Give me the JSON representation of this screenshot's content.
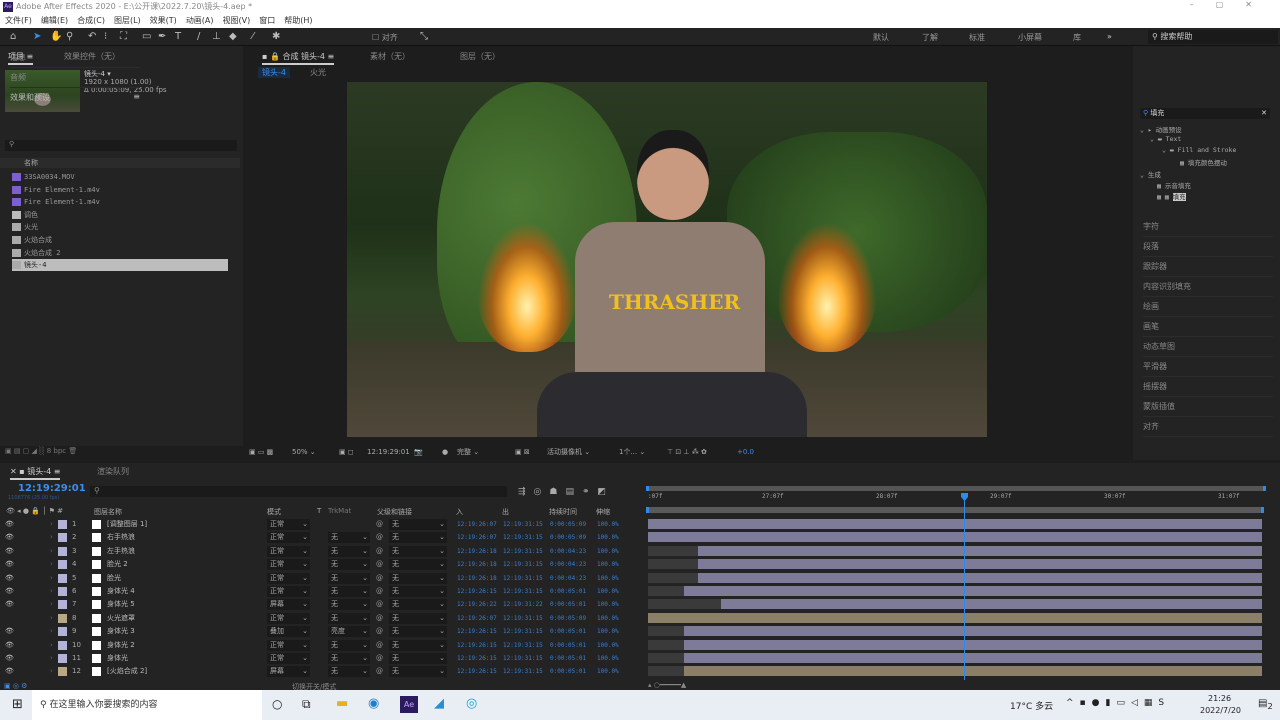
{
  "app": {
    "title": "Adobe After Effects 2020 - E:\\公开课\\2022.7.20\\镜头-4.aep *",
    "logo": "Ae"
  },
  "menu": [
    "文件(F)",
    "编辑(E)",
    "合成(C)",
    "图层(L)",
    "效果(T)",
    "动画(A)",
    "视图(V)",
    "窗口",
    "帮助(H)"
  ],
  "toolbar": {
    "align_label": "对齐",
    "workspaces": [
      "默认",
      "了解",
      "标准",
      "小屏幕",
      "库"
    ],
    "more": "»",
    "help_search": "搜索帮助"
  },
  "project": {
    "tab": "项目",
    "tab2": "效果控件（无）",
    "selected_name": "镜头-4 ▾",
    "resolution": "1920 x 1080 (1.00)",
    "duration": "Δ 0:00:05:09, 25.00 fps",
    "search_placeholder": "",
    "column_name": "名称",
    "bpc": "8 bpc",
    "items": [
      {
        "name": "33SA0034.MOV",
        "type": "video"
      },
      {
        "name": "Fire Element-1.m4v",
        "type": "video"
      },
      {
        "name": "Fire Element-1.m4v",
        "type": "video"
      },
      {
        "name": "调色",
        "type": "folder"
      },
      {
        "name": "火光",
        "type": "comp"
      },
      {
        "name": "火焰合成",
        "type": "comp"
      },
      {
        "name": "火焰合成 2",
        "type": "comp"
      },
      {
        "name": "镜头-4",
        "type": "comp",
        "selected": true
      }
    ]
  },
  "viewer": {
    "tab": "合成 镜头-4",
    "tab_footage": "素材（无）",
    "tab_layer": "图层（无）",
    "breadcrumb": [
      "镜头-4",
      "火光"
    ],
    "zoom": "50%",
    "timecode": "12:19:29:01",
    "resolution": "完整",
    "camera": "活动摄像机",
    "views": "1个...",
    "exposure": "+0.0",
    "shirt_text": "THRASHER"
  },
  "right_panel": {
    "info": "信息",
    "audio": "音频",
    "effects_presets": "效果和预设",
    "search_value": "填充",
    "tree": [
      "动画预设",
      "Text",
      "Fill and Stroke",
      "填充颜色摆动",
      "生成",
      "示音填充",
      "填充"
    ],
    "panels": [
      "字符",
      "段落",
      "跟踪器",
      "内容识别填充",
      "绘画",
      "画笔",
      "动态草图",
      "平滑器",
      "摇摆器",
      "蒙版插值",
      "对齐"
    ]
  },
  "timeline": {
    "tab": "镜头-4",
    "tab2": "渲染队列",
    "current_time": "12:19:29:01",
    "frame_info": "1108776 (25.00 fps)",
    "toggle_label": "切换开关/模式",
    "columns": {
      "name": "图层名称",
      "mode": "模式",
      "t": "T",
      "trkmat": "TrkMat",
      "parent": "父级和链接",
      "in": "入",
      "out": "出",
      "duration": "持续时间",
      "stretch": "伸缩"
    },
    "ruler": [
      ":07f",
      "27:07f",
      "28:07f",
      "29:07f",
      "30:07f",
      "31:07f"
    ],
    "layers": [
      {
        "num": "1",
        "name": "[调整图层 1]",
        "mode": "正常",
        "trkmat": "",
        "parent": "无",
        "in": "12:19:26:07",
        "out": "12:19:31:15",
        "dur": "0:00:05:09",
        "stretch": "100.0%",
        "color": "#b5b2d8",
        "bar": "#7e7b98",
        "start": 0
      },
      {
        "num": "2",
        "name": "右手热浪",
        "mode": "正常",
        "trkmat": "无",
        "parent": "无",
        "in": "12:19:26:07",
        "out": "12:19:31:15",
        "dur": "0:00:05:09",
        "stretch": "100.0%",
        "color": "#b5b2d8",
        "bar": "#7e7b98",
        "start": 0
      },
      {
        "num": "3",
        "name": "左手热浪",
        "mode": "正常",
        "trkmat": "无",
        "parent": "无",
        "in": "12:19:26:18",
        "out": "12:19:31:15",
        "dur": "0:00:04:23",
        "stretch": "100.0%",
        "color": "#b5b2d8",
        "bar": "#7e7b98",
        "start": 11
      },
      {
        "num": "4",
        "name": "脸光 2",
        "mode": "正常",
        "trkmat": "无",
        "parent": "无",
        "in": "12:19:26:18",
        "out": "12:19:31:15",
        "dur": "0:00:04:23",
        "stretch": "100.0%",
        "color": "#b5b2d8",
        "bar": "#7e7b98",
        "start": 11
      },
      {
        "num": "5",
        "name": "脸光",
        "mode": "正常",
        "trkmat": "无",
        "parent": "无",
        "in": "12:19:26:18",
        "out": "12:19:31:15",
        "dur": "0:00:04:23",
        "stretch": "100.0%",
        "color": "#b5b2d8",
        "bar": "#7e7b98",
        "start": 11
      },
      {
        "num": "6",
        "name": "身体光 4",
        "mode": "正常",
        "trkmat": "无",
        "parent": "无",
        "in": "12:19:26:15",
        "out": "12:19:31:15",
        "dur": "0:00:05:01",
        "stretch": "100.0%",
        "color": "#b5b2d8",
        "bar": "#7e7b98",
        "start": 8
      },
      {
        "num": "7",
        "name": "身体光 5",
        "mode": "屏幕",
        "trkmat": "无",
        "parent": "无",
        "in": "12:19:26:22",
        "out": "12:19:31:22",
        "dur": "0:00:05:01",
        "stretch": "100.0%",
        "color": "#b5b2d8",
        "bar": "#7e7b98",
        "start": 16
      },
      {
        "num": "8",
        "name": "火光遮罩",
        "mode": "正常",
        "trkmat": "无",
        "parent": "无",
        "in": "12:19:26:07",
        "out": "12:19:31:15",
        "dur": "0:00:05:09",
        "stretch": "100.0%",
        "color": "#b9a886",
        "bar": "#8c7f68",
        "start": 0
      },
      {
        "num": "9",
        "name": "身体光 3",
        "mode": "叠加",
        "trkmat": "亮度",
        "parent": "无",
        "in": "12:19:26:15",
        "out": "12:19:31:15",
        "dur": "0:00:05:01",
        "stretch": "100.0%",
        "color": "#b5b2d8",
        "bar": "#7e7b98",
        "start": 8
      },
      {
        "num": "10",
        "name": "身体光 2",
        "mode": "正常",
        "trkmat": "无",
        "parent": "无",
        "in": "12:19:26:15",
        "out": "12:19:31:15",
        "dur": "0:00:05:01",
        "stretch": "100.0%",
        "color": "#b5b2d8",
        "bar": "#7e7b98",
        "start": 8
      },
      {
        "num": "11",
        "name": "身体光",
        "mode": "正常",
        "trkmat": "无",
        "parent": "无",
        "in": "12:19:26:15",
        "out": "12:19:31:15",
        "dur": "0:00:05:01",
        "stretch": "100.0%",
        "color": "#b5b2d8",
        "bar": "#7e7b98",
        "start": 8
      },
      {
        "num": "12",
        "name": "[火焰合成 2]",
        "mode": "屏幕",
        "trkmat": "无",
        "parent": "无",
        "in": "12:19:26:15",
        "out": "12:19:31:15",
        "dur": "0:00:05:01",
        "stretch": "100.0%",
        "color": "#b9a886",
        "bar": "#8c7f68",
        "start": 8
      }
    ]
  },
  "taskbar": {
    "search_placeholder": "在这里输入你要搜索的内容",
    "weather": "17°C 多云",
    "time": "21:26",
    "date": "2022/7/20",
    "notifications": "2"
  },
  "colors": {
    "accent": "#2d8ceb",
    "timecode": "#3a7fd0",
    "panel_bg": "#232323"
  }
}
